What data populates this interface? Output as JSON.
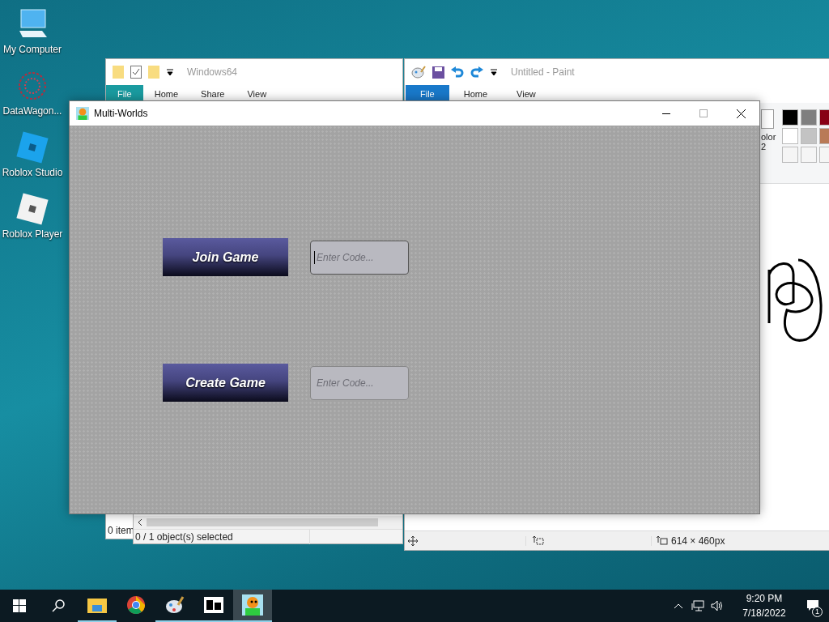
{
  "desktop_icons": [
    {
      "label": "My Computer",
      "kind": "computer"
    },
    {
      "label": "DataWagon...",
      "kind": "web"
    },
    {
      "label": "Roblox Studio",
      "kind": "studio"
    },
    {
      "label": "Roblox Player",
      "kind": "player"
    }
  ],
  "explorer": {
    "title": "Windows64",
    "tabs": [
      {
        "label": "File",
        "selected": true
      },
      {
        "label": "Home",
        "selected": false
      },
      {
        "label": "Share",
        "selected": false
      },
      {
        "label": "View",
        "selected": false
      }
    ],
    "status_back": "0 item",
    "status": "0 / 1 object(s) selected"
  },
  "paint": {
    "title": "Untitled - Paint",
    "tabs": [
      {
        "label": "File",
        "selected": true
      },
      {
        "label": "Home",
        "selected": false
      },
      {
        "label": "View",
        "selected": false
      }
    ],
    "color_label": "olor",
    "color_number": "2",
    "palette": [
      {
        "color": "#000000"
      },
      {
        "color": "#7f7f7f"
      },
      {
        "color": "#880015"
      },
      {
        "color": "#ffffff"
      },
      {
        "color": "#c3c3c3"
      },
      {
        "color": "#b97a57"
      },
      {
        "color": "#f5f5f5"
      },
      {
        "color": "#f5f5f5"
      },
      {
        "color": "#f5f5f5"
      }
    ],
    "size": "614 × 460px"
  },
  "app": {
    "title": "Multi-Worlds",
    "rows": [
      {
        "button": "Join Game",
        "placeholder": "Enter Code...",
        "focused": true
      },
      {
        "button": "Create Game",
        "placeholder": "Enter Code...",
        "focused": false
      }
    ]
  },
  "taskbar": {
    "apps": [
      {
        "kind": "explorer",
        "running": true,
        "selected": false
      },
      {
        "kind": "chrome",
        "running": false,
        "selected": false
      },
      {
        "kind": "paint",
        "running": true,
        "selected": false
      },
      {
        "kind": "archive",
        "running": true,
        "selected": false
      },
      {
        "kind": "game",
        "running": true,
        "selected": true
      }
    ]
  },
  "tray": {
    "time": "9:20 PM",
    "date": "7/18/2022",
    "notifications": "1"
  }
}
